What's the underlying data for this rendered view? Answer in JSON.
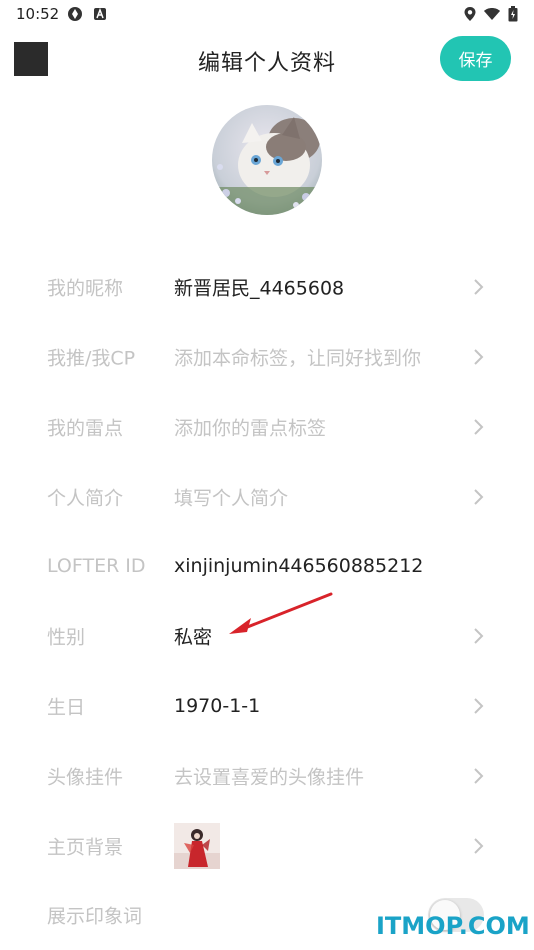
{
  "status_bar": {
    "time": "10:52",
    "left_icons": [
      "sync-icon",
      "a-badge-icon"
    ],
    "right_icons": [
      "location-icon",
      "wifi-icon",
      "battery-icon"
    ]
  },
  "header": {
    "title": "编辑个人资料",
    "save_label": "保存",
    "accent_color": "#22c5b3"
  },
  "rows": [
    {
      "label": "我的昵称",
      "value": "新晋居民_4465608",
      "placeholder": false,
      "chevron": true
    },
    {
      "label": "我推/我CP",
      "value": "添加本命标签，让同好找到你",
      "placeholder": true,
      "chevron": true
    },
    {
      "label": "我的雷点",
      "value": "添加你的雷点标签",
      "placeholder": true,
      "chevron": true
    },
    {
      "label": "个人简介",
      "value": "填写个人简介",
      "placeholder": true,
      "chevron": true
    },
    {
      "label": "LOFTER ID",
      "value": "xinjinjumin446560885212",
      "placeholder": false,
      "chevron": false
    },
    {
      "label": "性别",
      "value": "私密",
      "placeholder": false,
      "chevron": true
    },
    {
      "label": "生日",
      "value": "1970-1-1",
      "placeholder": false,
      "chevron": true
    },
    {
      "label": "头像挂件",
      "value": "去设置喜爱的头像挂件",
      "placeholder": true,
      "chevron": true
    },
    {
      "label": "主页背景",
      "value": "",
      "placeholder": false,
      "chevron": true
    },
    {
      "label": "展示印象词",
      "value": "",
      "placeholder": false,
      "chevron": false
    }
  ],
  "impression_toggle": {
    "on": false
  },
  "watermark": "ITMOP.COM"
}
